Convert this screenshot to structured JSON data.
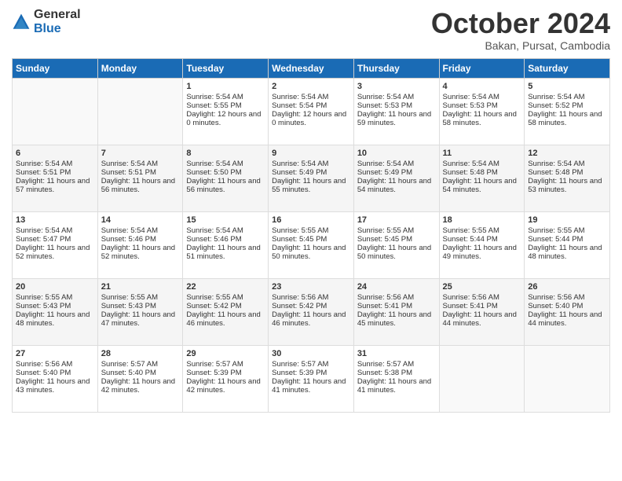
{
  "logo": {
    "general": "General",
    "blue": "Blue"
  },
  "title": "October 2024",
  "location": "Bakan, Pursat, Cambodia",
  "headers": [
    "Sunday",
    "Monday",
    "Tuesday",
    "Wednesday",
    "Thursday",
    "Friday",
    "Saturday"
  ],
  "weeks": [
    [
      {
        "day": "",
        "sunrise": "",
        "sunset": "",
        "daylight": ""
      },
      {
        "day": "",
        "sunrise": "",
        "sunset": "",
        "daylight": ""
      },
      {
        "day": "1",
        "sunrise": "Sunrise: 5:54 AM",
        "sunset": "Sunset: 5:55 PM",
        "daylight": "Daylight: 12 hours and 0 minutes."
      },
      {
        "day": "2",
        "sunrise": "Sunrise: 5:54 AM",
        "sunset": "Sunset: 5:54 PM",
        "daylight": "Daylight: 12 hours and 0 minutes."
      },
      {
        "day": "3",
        "sunrise": "Sunrise: 5:54 AM",
        "sunset": "Sunset: 5:53 PM",
        "daylight": "Daylight: 11 hours and 59 minutes."
      },
      {
        "day": "4",
        "sunrise": "Sunrise: 5:54 AM",
        "sunset": "Sunset: 5:53 PM",
        "daylight": "Daylight: 11 hours and 58 minutes."
      },
      {
        "day": "5",
        "sunrise": "Sunrise: 5:54 AM",
        "sunset": "Sunset: 5:52 PM",
        "daylight": "Daylight: 11 hours and 58 minutes."
      }
    ],
    [
      {
        "day": "6",
        "sunrise": "Sunrise: 5:54 AM",
        "sunset": "Sunset: 5:51 PM",
        "daylight": "Daylight: 11 hours and 57 minutes."
      },
      {
        "day": "7",
        "sunrise": "Sunrise: 5:54 AM",
        "sunset": "Sunset: 5:51 PM",
        "daylight": "Daylight: 11 hours and 56 minutes."
      },
      {
        "day": "8",
        "sunrise": "Sunrise: 5:54 AM",
        "sunset": "Sunset: 5:50 PM",
        "daylight": "Daylight: 11 hours and 56 minutes."
      },
      {
        "day": "9",
        "sunrise": "Sunrise: 5:54 AM",
        "sunset": "Sunset: 5:49 PM",
        "daylight": "Daylight: 11 hours and 55 minutes."
      },
      {
        "day": "10",
        "sunrise": "Sunrise: 5:54 AM",
        "sunset": "Sunset: 5:49 PM",
        "daylight": "Daylight: 11 hours and 54 minutes."
      },
      {
        "day": "11",
        "sunrise": "Sunrise: 5:54 AM",
        "sunset": "Sunset: 5:48 PM",
        "daylight": "Daylight: 11 hours and 54 minutes."
      },
      {
        "day": "12",
        "sunrise": "Sunrise: 5:54 AM",
        "sunset": "Sunset: 5:48 PM",
        "daylight": "Daylight: 11 hours and 53 minutes."
      }
    ],
    [
      {
        "day": "13",
        "sunrise": "Sunrise: 5:54 AM",
        "sunset": "Sunset: 5:47 PM",
        "daylight": "Daylight: 11 hours and 52 minutes."
      },
      {
        "day": "14",
        "sunrise": "Sunrise: 5:54 AM",
        "sunset": "Sunset: 5:46 PM",
        "daylight": "Daylight: 11 hours and 52 minutes."
      },
      {
        "day": "15",
        "sunrise": "Sunrise: 5:54 AM",
        "sunset": "Sunset: 5:46 PM",
        "daylight": "Daylight: 11 hours and 51 minutes."
      },
      {
        "day": "16",
        "sunrise": "Sunrise: 5:55 AM",
        "sunset": "Sunset: 5:45 PM",
        "daylight": "Daylight: 11 hours and 50 minutes."
      },
      {
        "day": "17",
        "sunrise": "Sunrise: 5:55 AM",
        "sunset": "Sunset: 5:45 PM",
        "daylight": "Daylight: 11 hours and 50 minutes."
      },
      {
        "day": "18",
        "sunrise": "Sunrise: 5:55 AM",
        "sunset": "Sunset: 5:44 PM",
        "daylight": "Daylight: 11 hours and 49 minutes."
      },
      {
        "day": "19",
        "sunrise": "Sunrise: 5:55 AM",
        "sunset": "Sunset: 5:44 PM",
        "daylight": "Daylight: 11 hours and 48 minutes."
      }
    ],
    [
      {
        "day": "20",
        "sunrise": "Sunrise: 5:55 AM",
        "sunset": "Sunset: 5:43 PM",
        "daylight": "Daylight: 11 hours and 48 minutes."
      },
      {
        "day": "21",
        "sunrise": "Sunrise: 5:55 AM",
        "sunset": "Sunset: 5:43 PM",
        "daylight": "Daylight: 11 hours and 47 minutes."
      },
      {
        "day": "22",
        "sunrise": "Sunrise: 5:55 AM",
        "sunset": "Sunset: 5:42 PM",
        "daylight": "Daylight: 11 hours and 46 minutes."
      },
      {
        "day": "23",
        "sunrise": "Sunrise: 5:56 AM",
        "sunset": "Sunset: 5:42 PM",
        "daylight": "Daylight: 11 hours and 46 minutes."
      },
      {
        "day": "24",
        "sunrise": "Sunrise: 5:56 AM",
        "sunset": "Sunset: 5:41 PM",
        "daylight": "Daylight: 11 hours and 45 minutes."
      },
      {
        "day": "25",
        "sunrise": "Sunrise: 5:56 AM",
        "sunset": "Sunset: 5:41 PM",
        "daylight": "Daylight: 11 hours and 44 minutes."
      },
      {
        "day": "26",
        "sunrise": "Sunrise: 5:56 AM",
        "sunset": "Sunset: 5:40 PM",
        "daylight": "Daylight: 11 hours and 44 minutes."
      }
    ],
    [
      {
        "day": "27",
        "sunrise": "Sunrise: 5:56 AM",
        "sunset": "Sunset: 5:40 PM",
        "daylight": "Daylight: 11 hours and 43 minutes."
      },
      {
        "day": "28",
        "sunrise": "Sunrise: 5:57 AM",
        "sunset": "Sunset: 5:40 PM",
        "daylight": "Daylight: 11 hours and 42 minutes."
      },
      {
        "day": "29",
        "sunrise": "Sunrise: 5:57 AM",
        "sunset": "Sunset: 5:39 PM",
        "daylight": "Daylight: 11 hours and 42 minutes."
      },
      {
        "day": "30",
        "sunrise": "Sunrise: 5:57 AM",
        "sunset": "Sunset: 5:39 PM",
        "daylight": "Daylight: 11 hours and 41 minutes."
      },
      {
        "day": "31",
        "sunrise": "Sunrise: 5:57 AM",
        "sunset": "Sunset: 5:38 PM",
        "daylight": "Daylight: 11 hours and 41 minutes."
      },
      {
        "day": "",
        "sunrise": "",
        "sunset": "",
        "daylight": ""
      },
      {
        "day": "",
        "sunrise": "",
        "sunset": "",
        "daylight": ""
      }
    ]
  ]
}
